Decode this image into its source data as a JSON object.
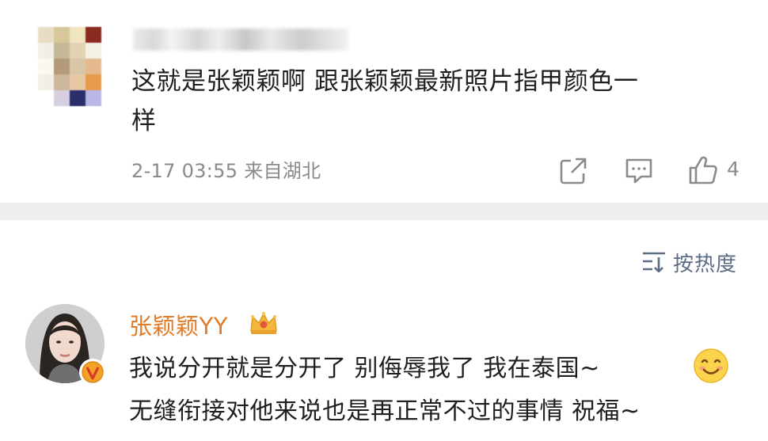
{
  "top_comment": {
    "text": "这就是张颖颖啊 跟张颖颖最新照片指甲颜色一样",
    "line1": "这就是张颖颖啊 跟张颖颖最新照片指甲颜色一",
    "line2": "样",
    "date": "2-17 03:55",
    "location": "来自湖北",
    "like_count": "4",
    "icons": [
      "share-icon",
      "comment-icon",
      "like-icon"
    ]
  },
  "sort": {
    "label": "按热度",
    "icon": "sort-icon",
    "color": "#5d6d86"
  },
  "reply": {
    "username": "张颖颖YY",
    "username_color": "#e07c2a",
    "badge_icon": "crown-icon",
    "verified_icon": "verified-v-icon",
    "line1": "我说分开就是分开了 别侮辱我了 我在泰国~",
    "line2": "无缝衔接对他来说也是再正常不过的事情 祝福~",
    "emoji": "smile-icon"
  }
}
